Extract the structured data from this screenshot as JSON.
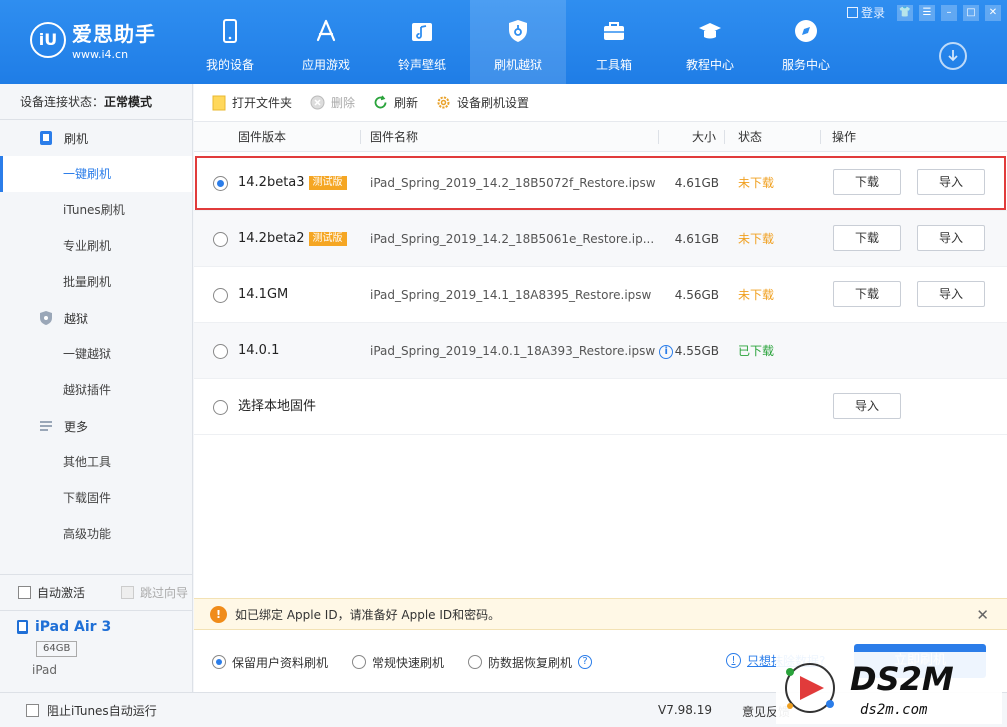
{
  "header": {
    "logo_title": "爱思助手",
    "logo_url": "www.i4.cn",
    "logo_mark": "iU",
    "login": "登录",
    "nav": [
      {
        "label": "我的设备",
        "icon": "phone-icon"
      },
      {
        "label": "应用游戏",
        "icon": "appstore-icon"
      },
      {
        "label": "铃声壁纸",
        "icon": "music-icon"
      },
      {
        "label": "刷机越狱",
        "icon": "flash-shield-icon"
      },
      {
        "label": "工具箱",
        "icon": "toolbox-icon"
      },
      {
        "label": "教程中心",
        "icon": "graduation-cap-icon"
      },
      {
        "label": "服务中心",
        "icon": "compass-icon"
      }
    ],
    "active_nav": "刷机越狱"
  },
  "sidebar": {
    "conn_label": "设备连接状态：",
    "conn_value": "正常模式",
    "groups": [
      {
        "label": "刷机",
        "icon": "flash-icon",
        "items": [
          "一键刷机",
          "iTunes刷机",
          "专业刷机",
          "批量刷机"
        ]
      },
      {
        "label": "越狱",
        "icon": "jailbreak-shield-icon",
        "items": [
          "一键越狱",
          "越狱插件"
        ]
      },
      {
        "label": "更多",
        "icon": "menu-icon",
        "items": [
          "其他工具",
          "下载固件",
          "高级功能"
        ]
      }
    ],
    "active_item": "一键刷机",
    "auto_activate": "自动激活",
    "skip_guide": "跳过向导",
    "device_name": "iPad Air 3",
    "capacity": "64GB",
    "device_model": "iPad"
  },
  "toolbar": {
    "open_folder": "打开文件夹",
    "delete": "删除",
    "refresh": "刷新",
    "settings": "设备刷机设置"
  },
  "table": {
    "headers": {
      "version": "固件版本",
      "name": "固件名称",
      "size": "大小",
      "status": "状态",
      "action": "操作"
    },
    "rows": [
      {
        "version": "14.2beta3",
        "tag": "测试版",
        "name": "iPad_Spring_2019_14.2_18B5072f_Restore.ipsw",
        "size": "4.61GB",
        "status": "未下载",
        "download": "下载",
        "import": "导入"
      },
      {
        "version": "14.2beta2",
        "tag": "测试版",
        "name": "iPad_Spring_2019_14.2_18B5061e_Restore.ip...",
        "size": "4.61GB",
        "status": "未下载",
        "download": "下载",
        "import": "导入"
      },
      {
        "version": "14.1GM",
        "tag": "",
        "name": "iPad_Spring_2019_14.1_18A8395_Restore.ipsw",
        "size": "4.56GB",
        "status": "未下载",
        "download": "下载",
        "import": "导入"
      },
      {
        "version": "14.0.1",
        "tag": "",
        "name": "iPad_Spring_2019_14.0.1_18A393_Restore.ipsw",
        "size": "4.55GB",
        "status": "已下载",
        "download": "",
        "import": ""
      },
      {
        "version": "选择本地固件",
        "tag": "",
        "name": "",
        "size": "",
        "status": "",
        "download": "",
        "import": "导入"
      }
    ],
    "selected_row": 0
  },
  "notice": {
    "text": "如已绑定 Apple ID，请准备好 Apple ID和密码。"
  },
  "options": {
    "items": [
      "保留用户资料刷机",
      "常规快速刷机",
      "防数据恢复刷机"
    ],
    "selected": 0,
    "erase_link": "只想抹除数据?",
    "flash_button": "立即刷机"
  },
  "statusbar": {
    "block_itunes": "阻止iTunes自动运行",
    "version": "V7.98.19",
    "feedback": "意见反馈"
  },
  "watermark": {
    "brand": "DS2M",
    "url": "ds2m.com"
  },
  "colors": {
    "header_blue": "#2f8ef0",
    "accent": "#2b7de9",
    "highlight_red": "#e13b3b",
    "not_downloaded": "#f0a020",
    "downloaded": "#2aa33b",
    "beta_tag": "#f5a623"
  }
}
